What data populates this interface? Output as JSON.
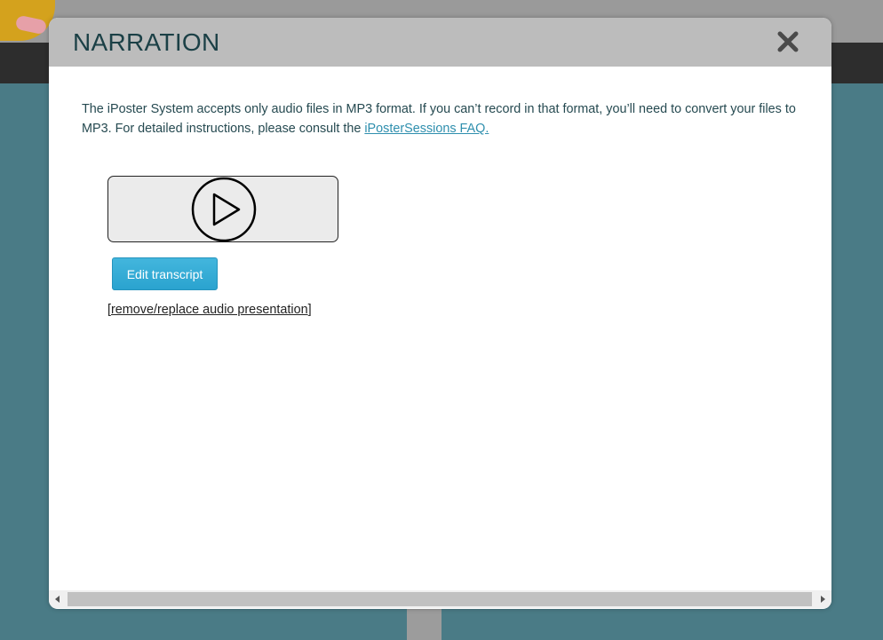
{
  "modal": {
    "title": "NARRATION",
    "close_icon": "close-x-icon",
    "description_before_link": "The iPoster System accepts only audio files in MP3 format. If you can’t record in that format, you’ll need to convert your files to MP3. For detailed instructions, please consult the ",
    "faq_link_text": "iPosterSessions FAQ.",
    "audio_player": {
      "play_icon": "play-icon"
    },
    "edit_transcript_label": "Edit transcript",
    "remove_link": {
      "open_bracket": "[",
      "label": "remove/replace audio presentation",
      "close_bracket": "]"
    },
    "scrollbar": {
      "left_icon": "scroll-left-arrow-icon",
      "right_icon": "scroll-right-arrow-icon"
    }
  },
  "colors": {
    "backdrop": "#4a7b86",
    "header": "#bcbcbc",
    "title_text": "#1b4046",
    "link": "#2f8fae",
    "button": "#2aa3cf"
  }
}
